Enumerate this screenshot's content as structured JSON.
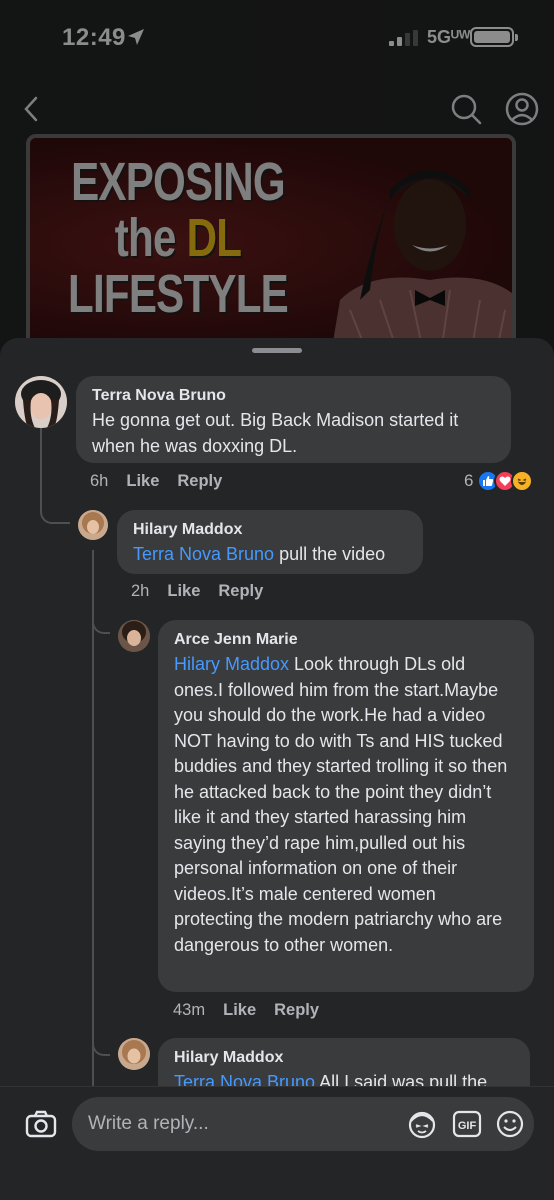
{
  "status_bar": {
    "time": "12:49",
    "network": "5Gᵁᵂ"
  },
  "video": {
    "title_line1": "EXPOSING",
    "title_line2_a": "the ",
    "title_line2_b": "DL",
    "title_line3": "LIFESTYLE"
  },
  "comments": [
    {
      "author": "Terra Nova Bruno",
      "mention": "",
      "text": "He gonna get out. Big Back Madison started it when he was doxxing DL.",
      "time": "6h",
      "like": "Like",
      "reply": "Reply",
      "reaction_count": "6"
    },
    {
      "author": "Hilary Maddox",
      "mention": "Terra Nova Bruno",
      "text": " pull the video",
      "time": "2h",
      "like": "Like",
      "reply": "Reply"
    },
    {
      "author": "Arce Jenn Marie",
      "mention": "Hilary Maddox",
      "text": " Look through DLs old ones.I followed him from the start.Maybe you should do the work.He had a video NOT having to do with Ts and HIS tucked buddies and they started trolling it so then he attacked back to the point they didn’t like it and they started harassing him saying they’d rape him,pulled out his personal information on one of their videos.It’s male centered women protecting the modern patriarchy who are dangerous to other women.",
      "time": "43m",
      "like": "Like",
      "reply": "Reply"
    },
    {
      "author": "Hilary Maddox",
      "mention": "Terra Nova Bruno",
      "text": " All I said was pull the",
      "time": "",
      "like": "",
      "reply": ""
    }
  ],
  "reply_bar": {
    "placeholder": "Write a reply...",
    "gif_label": "GIF"
  },
  "colors": {
    "mention": "#4599ff",
    "bubble": "#3a3b3c",
    "sheet": "#242526",
    "like_reaction": "#1877f2",
    "love_reaction": "#f33e58",
    "haha_reaction": "#f7b125"
  },
  "icons": [
    "location-arrow-icon",
    "signal-icon",
    "battery-icon",
    "back-chevron-icon",
    "search-icon",
    "profile-icon",
    "camera-icon",
    "avatar-sticker-icon",
    "gif-icon",
    "emoji-icon",
    "like-reaction-icon",
    "love-reaction-icon",
    "haha-reaction-icon"
  ]
}
